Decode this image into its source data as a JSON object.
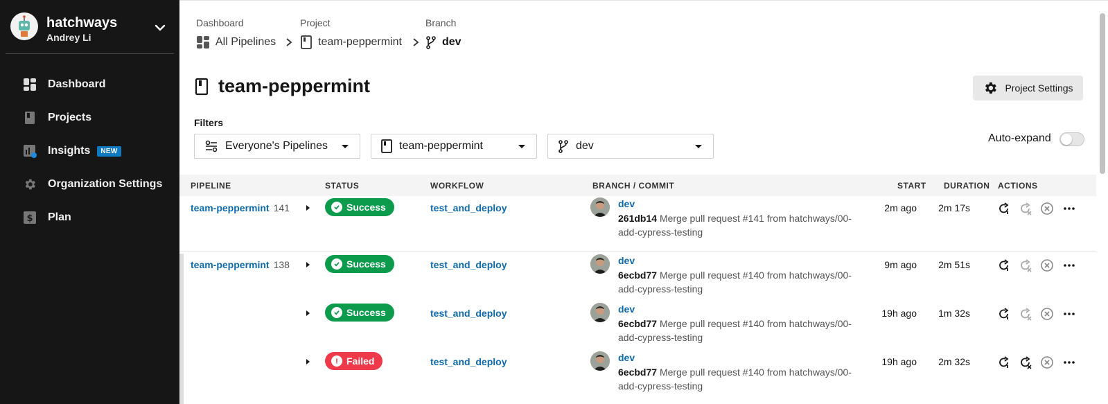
{
  "org": {
    "name": "hatchways",
    "user": "Andrey Li"
  },
  "sidebar": {
    "items": [
      {
        "label": "Dashboard",
        "icon": "dashboard-icon"
      },
      {
        "label": "Projects",
        "icon": "projects-icon"
      },
      {
        "label": "Insights",
        "icon": "insights-icon",
        "badge": "NEW"
      },
      {
        "label": "Organization Settings",
        "icon": "gear-icon"
      },
      {
        "label": "Plan",
        "icon": "plan-icon"
      }
    ]
  },
  "breadcrumbs": {
    "dashboard": {
      "label": "Dashboard",
      "value": "All Pipelines"
    },
    "project": {
      "label": "Project",
      "value": "team-peppermint"
    },
    "branch": {
      "label": "Branch",
      "value": "dev"
    }
  },
  "page": {
    "title": "team-peppermint",
    "settings_button": "Project Settings"
  },
  "filters": {
    "label": "Filters",
    "pipelines": "Everyone's Pipelines",
    "project": "team-peppermint",
    "branch": "dev",
    "autoexpand_label": "Auto-expand",
    "autoexpand_on": false
  },
  "table": {
    "headers": {
      "pipeline": "PIPELINE",
      "status": "STATUS",
      "workflow": "WORKFLOW",
      "branch_commit": "BRANCH / COMMIT",
      "start": "START",
      "duration": "DURATION",
      "actions": "ACTIONS"
    },
    "rows": [
      {
        "pipeline": "team-peppermint",
        "number": "141",
        "status": "Success",
        "workflow": "test_and_deploy",
        "branch": "dev",
        "sha": "261db14",
        "message": "Merge pull request #141 from hatchways/00-add-cypress-testing",
        "start": "2m ago",
        "duration": "2m 17s"
      },
      {
        "pipeline": "team-peppermint",
        "number": "138",
        "status": "Success",
        "workflow": "test_and_deploy",
        "branch": "dev",
        "sha": "6ecbd77",
        "message": "Merge pull request #140 from hatchways/00-add-cypress-testing",
        "start": "9m ago",
        "duration": "2m 51s"
      },
      {
        "pipeline": "",
        "number": "",
        "status": "Success",
        "workflow": "test_and_deploy",
        "branch": "dev",
        "sha": "6ecbd77",
        "message": "Merge pull request #140 from hatchways/00-add-cypress-testing",
        "start": "19h ago",
        "duration": "1m 32s"
      },
      {
        "pipeline": "",
        "number": "",
        "status": "Failed",
        "workflow": "test_and_deploy",
        "branch": "dev",
        "sha": "6ecbd77",
        "message": "Merge pull request #140 from hatchways/00-add-cypress-testing",
        "start": "19h ago",
        "duration": "2m 32s"
      }
    ]
  },
  "colors": {
    "sidebar_bg": "#161616",
    "link": "#0f6aa9",
    "success": "#0c9b4c",
    "failed": "#ee3a4a",
    "badge": "#0f7ac1"
  }
}
